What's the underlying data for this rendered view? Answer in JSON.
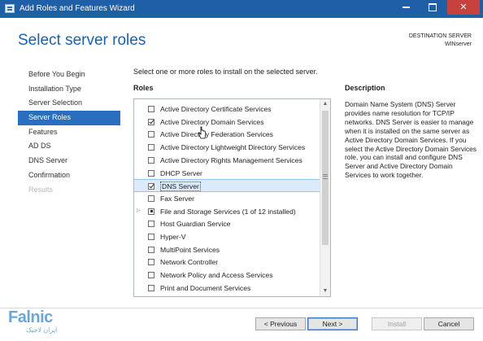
{
  "window": {
    "title": "Add Roles and Features Wizard"
  },
  "page": {
    "heading": "Select server roles"
  },
  "destination": {
    "label": "DESTINATION SERVER",
    "server": "WINserver"
  },
  "nav": [
    {
      "label": "Before You Begin",
      "state": "normal"
    },
    {
      "label": "Installation Type",
      "state": "normal"
    },
    {
      "label": "Server Selection",
      "state": "normal"
    },
    {
      "label": "Server Roles",
      "state": "active"
    },
    {
      "label": "Features",
      "state": "normal"
    },
    {
      "label": "AD DS",
      "state": "normal"
    },
    {
      "label": "DNS Server",
      "state": "normal"
    },
    {
      "label": "Confirmation",
      "state": "normal"
    },
    {
      "label": "Results",
      "state": "disabled"
    }
  ],
  "main": {
    "instruction": "Select one or more roles to install on the selected server.",
    "roles_header": "Roles",
    "roles": [
      {
        "label": "Active Directory Certificate Services",
        "checked": "no"
      },
      {
        "label": "Active Directory Domain Services",
        "checked": "yes"
      },
      {
        "label": "Active Directory Federation Services",
        "checked": "no"
      },
      {
        "label": "Active Directory Lightweight Directory Services",
        "checked": "no"
      },
      {
        "label": "Active Directory Rights Management Services",
        "checked": "no"
      },
      {
        "label": "DHCP Server",
        "checked": "no"
      },
      {
        "label": "DNS Server",
        "checked": "yes",
        "selected": true
      },
      {
        "label": "Fax Server",
        "checked": "no"
      },
      {
        "label": "File and Storage Services (1 of 12 installed)",
        "checked": "partial",
        "expandable": true
      },
      {
        "label": "Host Guardian Service",
        "checked": "no"
      },
      {
        "label": "Hyper-V",
        "checked": "no"
      },
      {
        "label": "MultiPoint Services",
        "checked": "no"
      },
      {
        "label": "Network Controller",
        "checked": "no"
      },
      {
        "label": "Network Policy and Access Services",
        "checked": "no"
      },
      {
        "label": "Print and Document Services",
        "checked": "no"
      }
    ]
  },
  "description": {
    "header": "Description",
    "text": "Domain Name System (DNS) Server provides name resolution for TCP/IP networks. DNS Server is easier to manage when it is installed on the same server as Active Directory Domain Services. If you select the Active Directory Domain Services role, you can install and configure DNS Server and Active Directory Domain Services to work together."
  },
  "buttons": {
    "previous": "< Previous",
    "next": "Next >",
    "install": "Install",
    "cancel": "Cancel"
  },
  "watermark": {
    "word": "Falnic",
    "sub": "ایران لاجیک"
  }
}
